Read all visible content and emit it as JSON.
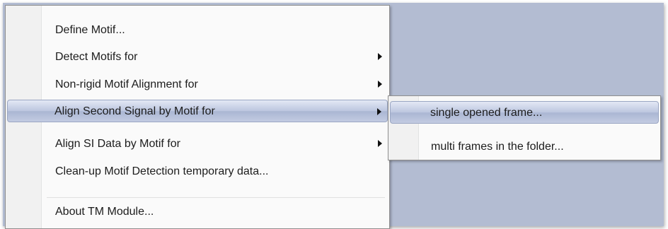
{
  "menu": {
    "items": [
      {
        "label": "Define Motif...",
        "has_submenu": false,
        "highlighted": false
      },
      {
        "label": "Detect Motifs for",
        "has_submenu": true,
        "highlighted": false
      },
      {
        "label": "Non-rigid Motif Alignment for",
        "has_submenu": true,
        "highlighted": false
      },
      {
        "label": "Align Second Signal by Motif for",
        "has_submenu": true,
        "highlighted": true
      },
      {
        "label": "Align SI Data by Motif for",
        "has_submenu": true,
        "highlighted": false
      },
      {
        "label": "Clean-up Motif Detection temporary data...",
        "has_submenu": false,
        "highlighted": false
      },
      {
        "label": "About TM Module...",
        "has_submenu": false,
        "highlighted": false
      }
    ]
  },
  "submenu": {
    "items": [
      {
        "label": "single opened frame...",
        "highlighted": true
      },
      {
        "label": "multi frames in the folder...",
        "highlighted": false
      }
    ]
  },
  "colors": {
    "backdrop": "#b3bcd2",
    "menu_background": "#fafafa",
    "highlight": "#bcc6df",
    "border": "#8f8f8f"
  }
}
